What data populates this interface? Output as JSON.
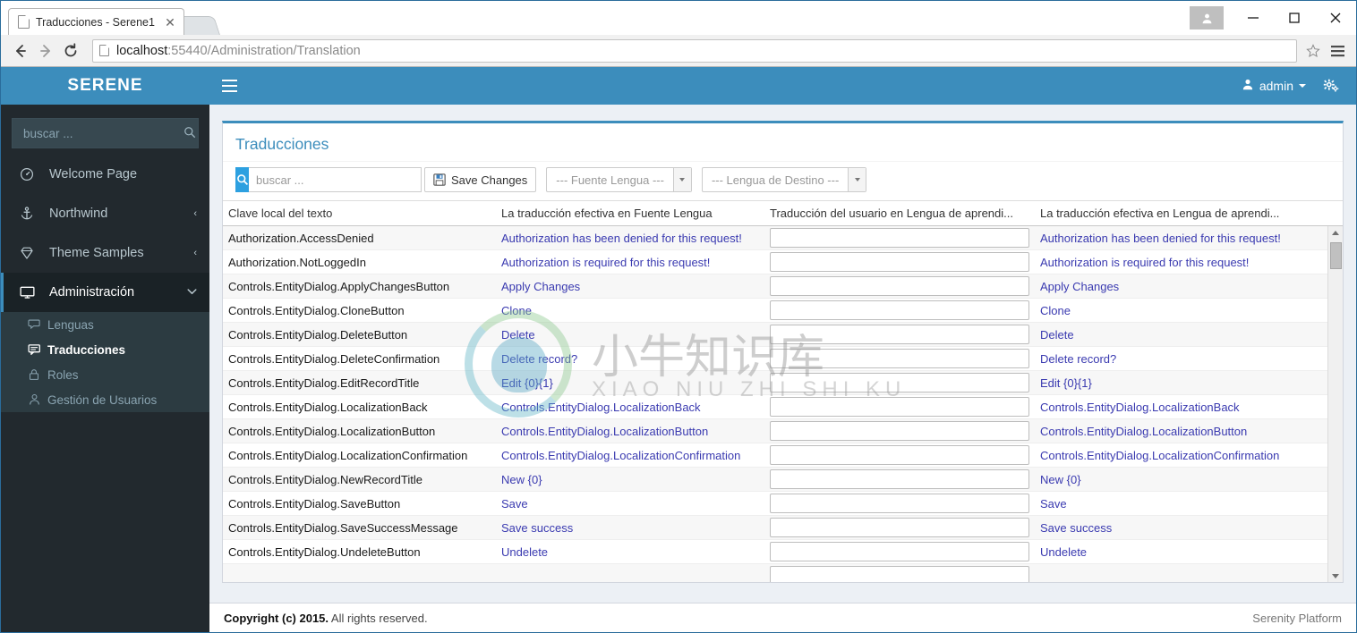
{
  "browser": {
    "tab_title": "Traducciones - Serene1",
    "tab_close_glyph": "✕",
    "url_host": "localhost",
    "url_rest": ":55440/Administration/Translation",
    "back_glyph": "←",
    "forward_glyph": "→",
    "reload_glyph": "⟳",
    "star_glyph": "☆",
    "menu_glyph": "≡",
    "minimize_glyph": "—",
    "maximize_glyph": "□",
    "close_glyph": "✕",
    "profile_glyph": "👤"
  },
  "sidebar": {
    "brand": "SERENE",
    "search_placeholder": "buscar ...",
    "search_value": "",
    "search_icon_glyph": "🔍",
    "items": [
      {
        "label": "Welcome Page",
        "icon": "dashboard-icon",
        "glyph": "⊙",
        "arrow": "",
        "active": false
      },
      {
        "label": "Northwind",
        "icon": "anchor-icon",
        "glyph": "⚓",
        "arrow": "‹",
        "active": false
      },
      {
        "label": "Theme Samples",
        "icon": "diamond-icon",
        "glyph": "♦",
        "arrow": "‹",
        "active": false
      },
      {
        "label": "Administración",
        "icon": "desktop-icon",
        "glyph": "▣",
        "arrow": "∨",
        "active": true
      }
    ],
    "subitems": [
      {
        "label": "Lenguas",
        "icon": "comments-icon",
        "glyph": "☷",
        "active": false
      },
      {
        "label": "Traducciones",
        "icon": "comment-icon",
        "glyph": "☷",
        "active": true
      },
      {
        "label": "Roles",
        "icon": "lock-icon",
        "glyph": "⚿",
        "active": false
      },
      {
        "label": "Gestión de Usuarios",
        "icon": "users-icon",
        "glyph": "♟",
        "active": false
      }
    ]
  },
  "topbar": {
    "toggle_icon": "hamburger-icon",
    "user_label": "admin",
    "user_icon_glyph": "👤",
    "gear_icon_glyph": "⚙"
  },
  "panel": {
    "title": "Traducciones"
  },
  "toolbar": {
    "search_icon_glyph": "🔍",
    "search_placeholder": "buscar ...",
    "search_value": "",
    "save_label": "Save Changes",
    "save_icon": "floppy-disk-icon",
    "source_language_label": "--- Fuente Lengua ---",
    "target_language_label": "--- Lengua de Destino ---"
  },
  "grid": {
    "columns": [
      "Clave local del texto",
      "La traducción efectiva en Fuente Lengua",
      "Traducción del usuario en Lengua de aprendi...",
      "La traducción efectiva en Lengua de aprendi..."
    ],
    "rows": [
      {
        "key": "Authorization.AccessDenied",
        "source": "Authorization has been denied for this request!",
        "user": "",
        "effective": "Authorization has been denied for this request!"
      },
      {
        "key": "Authorization.NotLoggedIn",
        "source": "Authorization is required for this request!",
        "user": "",
        "effective": "Authorization is required for this request!"
      },
      {
        "key": "Controls.EntityDialog.ApplyChangesButton",
        "source": "Apply Changes",
        "user": "",
        "effective": "Apply Changes"
      },
      {
        "key": "Controls.EntityDialog.CloneButton",
        "source": "Clone",
        "user": "",
        "effective": "Clone"
      },
      {
        "key": "Controls.EntityDialog.DeleteButton",
        "source": "Delete",
        "user": "",
        "effective": "Delete"
      },
      {
        "key": "Controls.EntityDialog.DeleteConfirmation",
        "source": "Delete record?",
        "user": "",
        "effective": "Delete record?"
      },
      {
        "key": "Controls.EntityDialog.EditRecordTitle",
        "source": "Edit {0}{1}",
        "user": "",
        "effective": "Edit {0}{1}"
      },
      {
        "key": "Controls.EntityDialog.LocalizationBack",
        "source": "Controls.EntityDialog.LocalizationBack",
        "user": "",
        "effective": "Controls.EntityDialog.LocalizationBack"
      },
      {
        "key": "Controls.EntityDialog.LocalizationButton",
        "source": "Controls.EntityDialog.LocalizationButton",
        "user": "",
        "effective": "Controls.EntityDialog.LocalizationButton"
      },
      {
        "key": "Controls.EntityDialog.LocalizationConfirmation",
        "source": "Controls.EntityDialog.LocalizationConfirmation",
        "user": "",
        "effective": "Controls.EntityDialog.LocalizationConfirmation"
      },
      {
        "key": "Controls.EntityDialog.NewRecordTitle",
        "source": "New {0}",
        "user": "",
        "effective": "New {0}"
      },
      {
        "key": "Controls.EntityDialog.SaveButton",
        "source": "Save",
        "user": "",
        "effective": "Save"
      },
      {
        "key": "Controls.EntityDialog.SaveSuccessMessage",
        "source": "Save success",
        "user": "",
        "effective": "Save success"
      },
      {
        "key": "Controls.EntityDialog.UndeleteButton",
        "source": "Undelete",
        "user": "",
        "effective": "Undelete"
      },
      {
        "key": "",
        "source": "",
        "user": "",
        "effective": ""
      }
    ]
  },
  "footer": {
    "copyright_strong": "Copyright (c) 2015.",
    "copyright_rest": " All rights reserved.",
    "right": "Serenity Platform"
  },
  "watermark": {
    "text": "小牛知识库",
    "subtext": "XIAO NIU ZHI SHI KU"
  },
  "colors": {
    "brand_blue": "#3c8dbc",
    "sidebar_dark": "#22292e",
    "sidebar_sub": "#2c3b41",
    "link_purple": "#3a3ab0",
    "accent_cyan": "#2da0e0"
  }
}
